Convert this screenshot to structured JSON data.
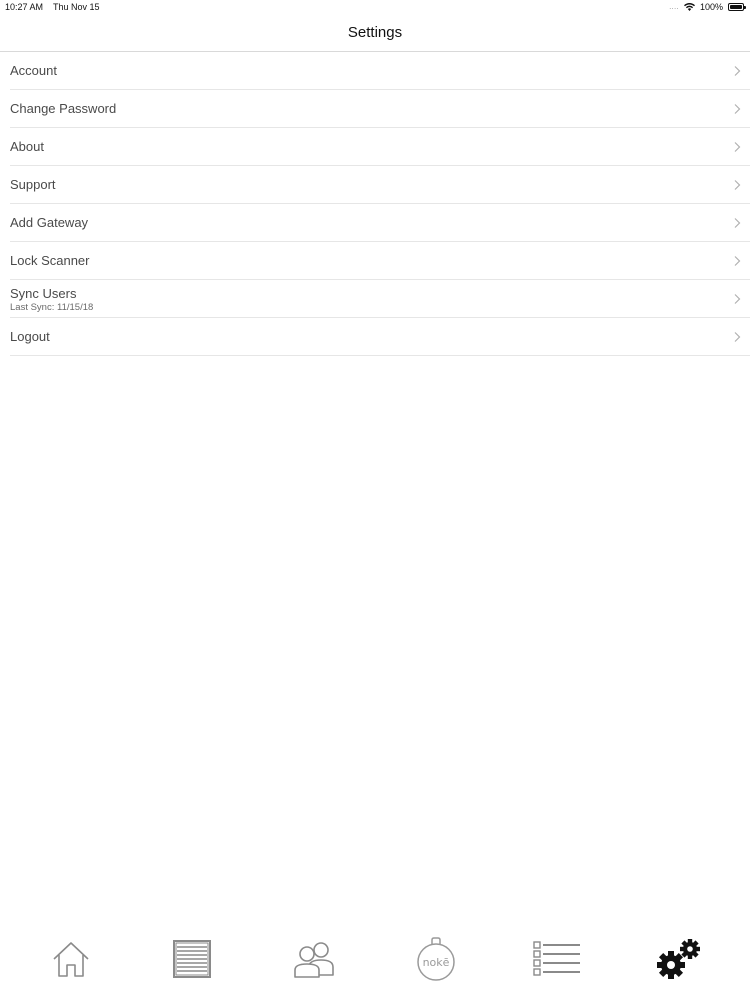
{
  "status": {
    "time": "10:27 AM",
    "date": "Thu Nov 15",
    "signal": "....",
    "wifi_icon": "wifi-icon",
    "battery_text": "100%"
  },
  "nav": {
    "title": "Settings"
  },
  "settings": {
    "items": [
      {
        "label": "Account"
      },
      {
        "label": "Change Password"
      },
      {
        "label": "About"
      },
      {
        "label": "Support"
      },
      {
        "label": "Add Gateway"
      },
      {
        "label": "Lock Scanner"
      },
      {
        "label": "Sync Users",
        "sub": "Last Sync: 11/15/18"
      },
      {
        "label": "Logout"
      }
    ]
  },
  "tabs": [
    {
      "icon": "home-icon",
      "active": false
    },
    {
      "icon": "storage-unit-icon",
      "active": false
    },
    {
      "icon": "users-icon",
      "active": false
    },
    {
      "icon": "noke-lock-icon",
      "active": false,
      "logo_text": "nokē"
    },
    {
      "icon": "list-icon",
      "active": false
    },
    {
      "icon": "gears-icon",
      "active": true
    }
  ],
  "colors": {
    "inactive_icon": "#8a8a8a",
    "active_icon": "#111111",
    "separator": "#e6e6e6"
  }
}
